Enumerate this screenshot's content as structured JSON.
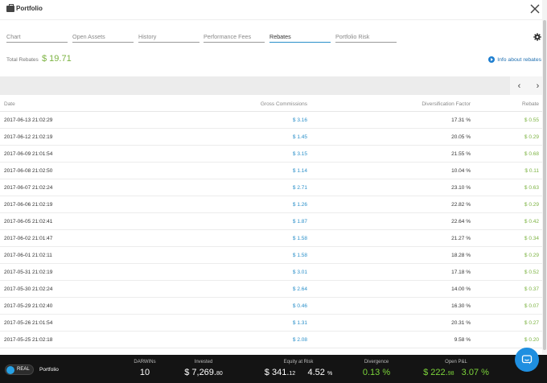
{
  "window": {
    "title": "Portfolio"
  },
  "tabs": [
    {
      "label": "Chart",
      "active": false
    },
    {
      "label": "Open Assets",
      "active": false
    },
    {
      "label": "History",
      "active": false
    },
    {
      "label": "Performance Fees",
      "active": false
    },
    {
      "label": "Rebates",
      "active": true
    },
    {
      "label": "Portfolio Risk",
      "active": false
    }
  ],
  "summary": {
    "total_label": "Total Rebates",
    "total_value": "$ 19.71",
    "info_link": "Info about rebates"
  },
  "pager": {
    "prev": "‹",
    "next": "›"
  },
  "table": {
    "headers": {
      "date": "Date",
      "gross": "Gross Commissions",
      "div": "Diversification Factor",
      "rebate": "Rebate"
    },
    "rows": [
      {
        "date": "2017-06-13 21:02:29",
        "gross": "$ 3.16",
        "div": "17.31 %",
        "rebate": "$ 0.55"
      },
      {
        "date": "2017-06-12 21:02:19",
        "gross": "$ 1.45",
        "div": "20.05 %",
        "rebate": "$ 0.29"
      },
      {
        "date": "2017-06-09 21:01:54",
        "gross": "$ 3.15",
        "div": "21.55 %",
        "rebate": "$ 0.68"
      },
      {
        "date": "2017-06-08 21:02:50",
        "gross": "$ 1.14",
        "div": "10.04 %",
        "rebate": "$ 0.11"
      },
      {
        "date": "2017-06-07 21:02:24",
        "gross": "$ 2.71",
        "div": "23.10 %",
        "rebate": "$ 0.63"
      },
      {
        "date": "2017-06-06 21:02:19",
        "gross": "$ 1.26",
        "div": "22.82 %",
        "rebate": "$ 0.29"
      },
      {
        "date": "2017-06-05 21:02:41",
        "gross": "$ 1.87",
        "div": "22.64 %",
        "rebate": "$ 0.42"
      },
      {
        "date": "2017-06-02 21:01:47",
        "gross": "$ 1.58",
        "div": "21.27 %",
        "rebate": "$ 0.34"
      },
      {
        "date": "2017-06-01 21:02:11",
        "gross": "$ 1.58",
        "div": "18.28 %",
        "rebate": "$ 0.29"
      },
      {
        "date": "2017-05-31 21:02:19",
        "gross": "$ 3.01",
        "div": "17.18 %",
        "rebate": "$ 0.52"
      },
      {
        "date": "2017-05-30 21:02:24",
        "gross": "$ 2.64",
        "div": "14.00 %",
        "rebate": "$ 0.37"
      },
      {
        "date": "2017-05-29 21:02:40",
        "gross": "$ 0.46",
        "div": "16.30 %",
        "rebate": "$ 0.07"
      },
      {
        "date": "2017-05-26 21:01:54",
        "gross": "$ 1.31",
        "div": "20.31 %",
        "rebate": "$ 0.27"
      },
      {
        "date": "2017-05-25 21:02:18",
        "gross": "$ 2.08",
        "div": "9.58 %",
        "rebate": "$ 0.20"
      }
    ]
  },
  "footer": {
    "mode": "REAL",
    "portfolio_label": "Portfolio",
    "darwins": {
      "label": "DARWINs",
      "value": "10"
    },
    "invested": {
      "label": "Invested",
      "main": "$ 7,269.",
      "cents": "80"
    },
    "equity": {
      "label": "Equity at Risk",
      "main": "$ 341.",
      "cents": "12",
      "pct": "4.52",
      "pct_unit": "%"
    },
    "divergence": {
      "label": "Divergence",
      "value": "0.13 %"
    },
    "pnl": {
      "label": "Open P&L",
      "main": "$ 222.",
      "cents": "98",
      "pct": "3.07 %"
    }
  },
  "colors": {
    "accent": "#2a8fc9",
    "positive": "#7cb342",
    "footer_bg": "#141414"
  }
}
